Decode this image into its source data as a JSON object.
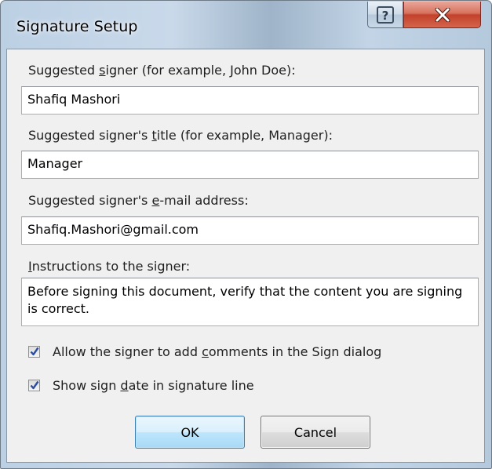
{
  "window": {
    "title": "Signature Setup",
    "help_glyph": "?",
    "help_icon": "help-question-icon",
    "close_icon": "close-x-icon",
    "close_color": "#c3412a"
  },
  "form": {
    "signer_label_pre": "Suggested ",
    "signer_label_key": "s",
    "signer_label_post": "igner (for example, John Doe):",
    "signer_value": "Shafiq Mashori",
    "title_label_pre": "Suggested signer's ",
    "title_label_key": "t",
    "title_label_post": "itle (for example, Manager):",
    "title_value": "Manager",
    "email_label_pre": "Suggested signer's ",
    "email_label_key": "e",
    "email_label_post": "-mail address:",
    "email_value": "Shafiq.Mashori@gmail.com",
    "instructions_label_key": "I",
    "instructions_label_post": "nstructions to the signer:",
    "instructions_value": "Before signing this document, verify that the content you are signing is correct."
  },
  "options": {
    "allow_comments_pre": "Allow the signer to add ",
    "allow_comments_key": "c",
    "allow_comments_post": "omments in the Sign dialog",
    "allow_comments_checked": true,
    "show_date_pre": "Show sign ",
    "show_date_key": "d",
    "show_date_post": "ate in signature line",
    "show_date_checked": true
  },
  "buttons": {
    "ok_label": "OK",
    "cancel_label": "Cancel"
  }
}
